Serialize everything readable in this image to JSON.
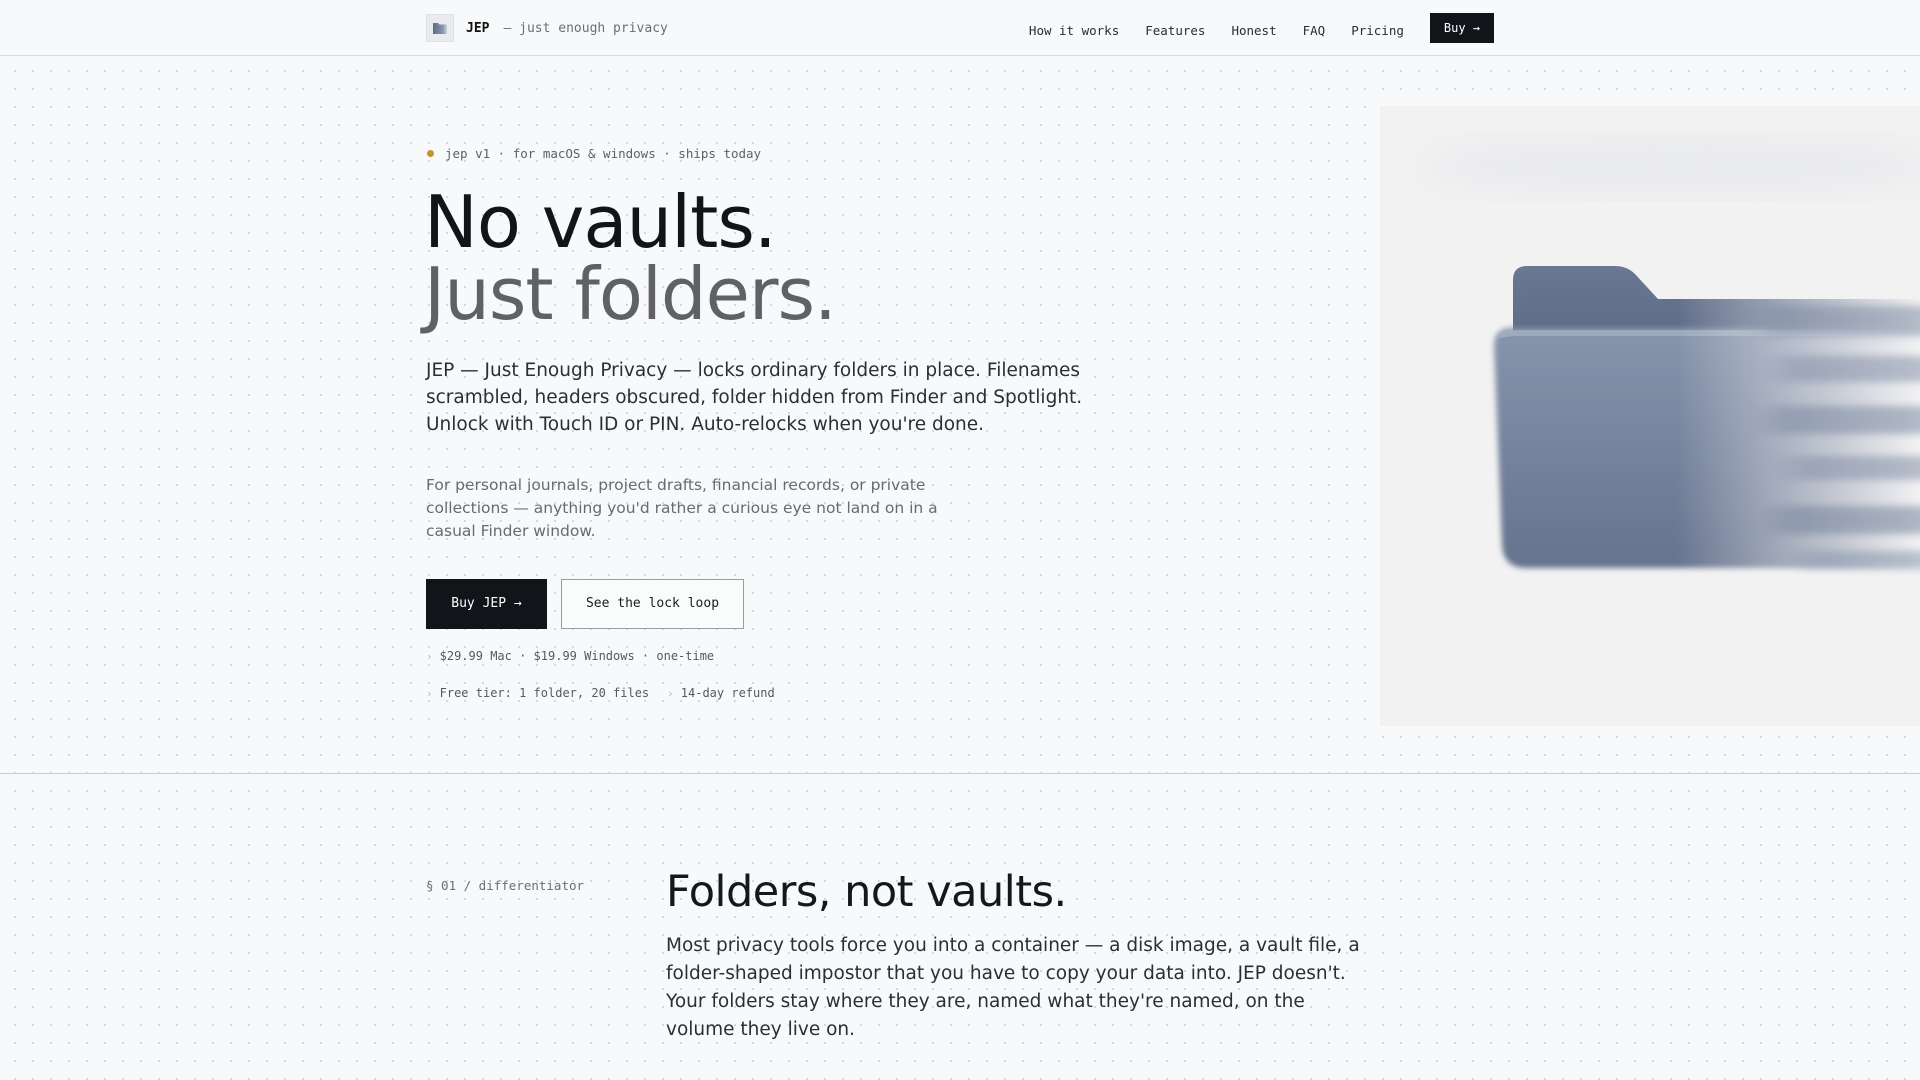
{
  "nav": {
    "brand": "JEP",
    "tagline": "— just enough privacy",
    "links": [
      "How it works",
      "Features",
      "Honest",
      "FAQ",
      "Pricing"
    ],
    "buy_label": "Buy →"
  },
  "hero": {
    "eyebrow": "jep v1 · for macOS & windows · ships today",
    "title_line1": "No vaults.",
    "title_line2": "Just folders.",
    "lead": "JEP — Just Enough Privacy — locks ordinary folders in place. Filenames scrambled, headers obscured, folder hidden from Finder and Spotlight. Unlock with Touch ID or PIN. Auto-relocks when you're done.",
    "sub": "For personal journals, project drafts, financial records, or private collections — anything you'd rather a curious eye not land on in a casual Finder window.",
    "cta_primary": "Buy JEP →",
    "cta_secondary": "See the lock loop",
    "price_line": "$29.99 Mac · $19.99 Windows · one-time",
    "free_tier": "Free tier: 1 folder, 20 files",
    "refund": "14-day refund",
    "caret": "›"
  },
  "section1": {
    "label": "§ 01 / differentiator",
    "title": "Folders, not vaults.",
    "body": "Most privacy tools force you into a container — a disk image, a vault file, a folder-shaped impostor that you have to copy your data into. JEP doesn't. Your folders stay where they are, named what they're named, on the volume they live on."
  },
  "icons": {
    "logo": "folder-logo-icon",
    "hero_art": "blurred-folder-illustration",
    "status_dot": "status-dot-icon"
  },
  "colors": {
    "background": "#f8f9fa",
    "ink": "#121417",
    "muted_title": "#5f6164",
    "accent_dot": "#c7912b",
    "button_dark": "#111418",
    "folder": "#6f7f99"
  }
}
